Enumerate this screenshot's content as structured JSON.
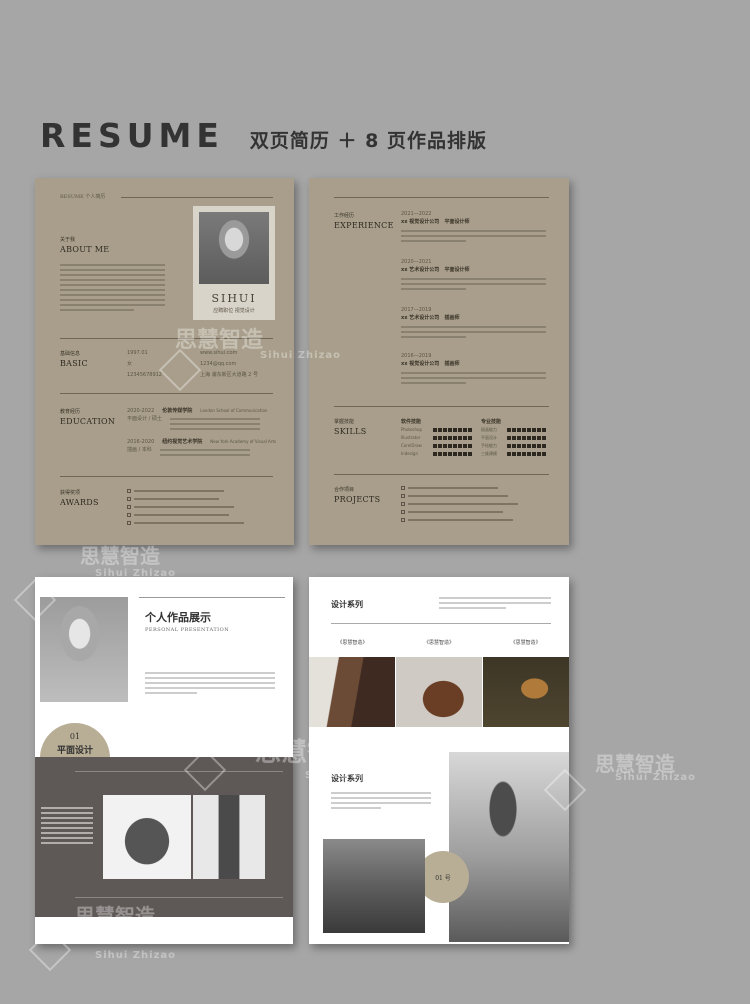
{
  "header": {
    "title": "RESUME",
    "subtitle": "双页简历 ＋ 8 页作品排版"
  },
  "page1": {
    "top_label": "RESUME 个人简历",
    "name": "SIHUI",
    "position": "应聘职位  视觉设计",
    "about": {
      "cn": "关于我",
      "en": "ABOUT ME"
    },
    "basic": {
      "cn": "基础信息",
      "en": "BASIC",
      "birth": "1997.01",
      "gender": "女",
      "phone": "12345678912",
      "site": "www.sihui.com",
      "email": "1234@qq.com",
      "address": "上海 浦东新区大道路 2 号"
    },
    "education": {
      "cn": "教育经历",
      "en": "EDUCATION",
      "items": [
        {
          "date": "2020-2022",
          "school": "伦敦传媒学院",
          "school_en": "London School of Communication",
          "degree": "平面设计 / 硕士"
        },
        {
          "date": "2016-2020",
          "school": "纽约视觉艺术学院",
          "school_en": "New York Academy of Visual Arts",
          "degree": "插画 / 本科"
        }
      ]
    },
    "awards": {
      "cn": "获得奖项",
      "en": "AWARDS"
    }
  },
  "page2": {
    "experience": {
      "cn": "工作经历",
      "en": "EXPERIENCE",
      "items": [
        {
          "date": "2021—2022",
          "company": "xx 视觉设计公司",
          "role": "平面设计师"
        },
        {
          "date": "2020—2021",
          "company": "xx 艺术设计公司",
          "role": "平面设计师"
        },
        {
          "date": "2017—2019",
          "company": "xx 艺术设计公司",
          "role": "插画师"
        },
        {
          "date": "2016—2019",
          "company": "xx 视觉设计公司",
          "role": "插画师"
        }
      ]
    },
    "skills": {
      "cn": "掌握技能",
      "en": "SKILLS",
      "software_label": "软件技能",
      "pro_label": "专业技能",
      "software": [
        "Photoshop",
        "Illustrator",
        "CorelDraw",
        "Indesign"
      ],
      "pro": [
        "插画能力",
        "平面设计",
        "手绘能力",
        "三维建模"
      ]
    },
    "projects": {
      "cn": "合作项目",
      "en": "PROJECTS"
    }
  },
  "page3": {
    "title": "个人作品展示",
    "subtitle": "PERSONAL PRESENTATION",
    "badge_num": "01",
    "badge_text": "平面设计"
  },
  "page4": {
    "series": "设计系列",
    "caption": "《思慧智造》",
    "series2": "设计系列",
    "badge": "01 号"
  },
  "watermark": {
    "cn": "思慧智造",
    "en": "Sihui Zhizao"
  },
  "colors": {
    "tan": "#a89e8b",
    "dark_band": "#5e5856",
    "background": "#a6a6a6"
  }
}
